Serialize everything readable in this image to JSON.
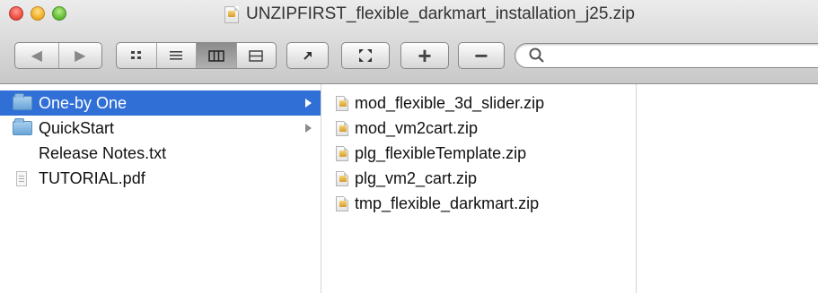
{
  "window": {
    "title": "UNZIPFIRST_flexible_darkmart_installation_j25.zip"
  },
  "toolbar": {
    "back_icon": "◀",
    "forward_icon": "▶",
    "plus_label": "+",
    "minus_label": "−",
    "search": {
      "value": "",
      "placeholder": ""
    },
    "active_view": "column"
  },
  "sidebar": {
    "items": [
      {
        "label": "One-by One",
        "kind": "folder",
        "selected": true,
        "has_children": true
      },
      {
        "label": "QuickStart",
        "kind": "folder",
        "selected": false,
        "has_children": true
      },
      {
        "label": "Release Notes.txt",
        "kind": "text-file",
        "selected": false,
        "has_children": false
      },
      {
        "label": "TUTORIAL.pdf",
        "kind": "pdf-file",
        "selected": false,
        "has_children": false
      }
    ]
  },
  "files": {
    "items": [
      {
        "label": "mod_flexible_3d_slider.zip"
      },
      {
        "label": "mod_vm2cart.zip"
      },
      {
        "label": "plg_flexibleTemplate.zip"
      },
      {
        "label": "plg_vm2_cart.zip"
      },
      {
        "label": "tmp_flexible_darkmart.zip"
      }
    ]
  },
  "colors": {
    "selection": "#2f6fd6",
    "folder": "#6aa4d8"
  }
}
